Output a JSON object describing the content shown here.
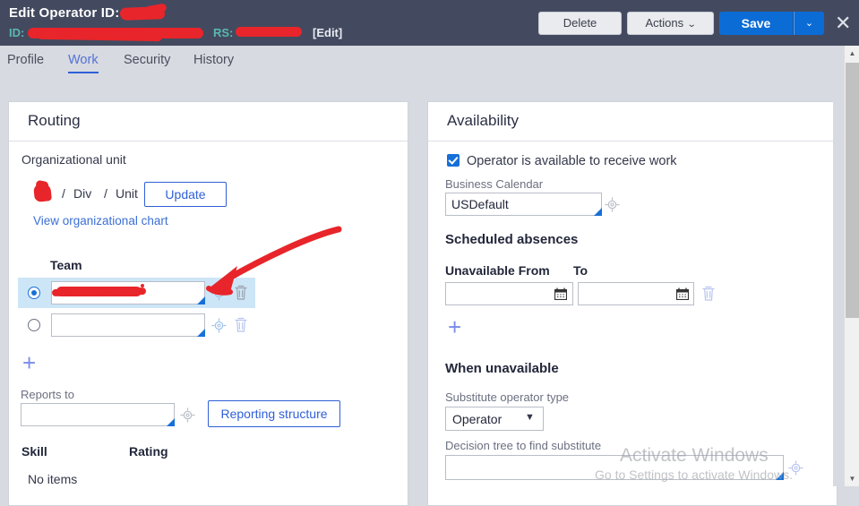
{
  "header": {
    "title": "Edit  Operator ID:",
    "id_label": "ID:",
    "rs_label": "RS:",
    "edit_link": "[Edit]",
    "delete_label": "Delete",
    "actions_label": "Actions",
    "actions_caret": "⌄",
    "save_label": "Save",
    "save_caret": "⌄",
    "close_icon": "✕",
    "bg_color": "#434a60",
    "accent_color": "#0c6cd6",
    "label_color": "#5bb8b0",
    "redaction_color": "#e8252a"
  },
  "tabs": [
    {
      "label": "Profile",
      "active": false
    },
    {
      "label": "Work",
      "active": true
    },
    {
      "label": "Security",
      "active": false
    },
    {
      "label": "History",
      "active": false
    }
  ],
  "routing": {
    "card_title": "Routing",
    "org_unit_label": "Organizational unit",
    "breadcrumb": {
      "sep1": "/",
      "div": "Div",
      "sep2": "/",
      "unit": "Unit"
    },
    "update_button": "Update",
    "org_chart_link": "View organizational chart",
    "team_header": "Team",
    "team_rows": [
      {
        "selected": true,
        "value": "",
        "redacted": true
      },
      {
        "selected": false,
        "value": "",
        "redacted": false
      }
    ],
    "add_team_icon": "+",
    "reports_to_label": "Reports to",
    "reports_to_value": "",
    "reporting_structure_button": "Reporting structure",
    "skill_header": "Skill",
    "rating_header": "Rating",
    "no_items_text": "No items"
  },
  "availability": {
    "card_title": "Availability",
    "available_checkbox_label": "Operator is available to receive work",
    "available_checked": true,
    "business_calendar_label": "Business Calendar",
    "business_calendar_value": "USDefault",
    "scheduled_absences_heading": "Scheduled absences",
    "unavailable_from_header": "Unavailable From",
    "to_header": "To",
    "absence_rows": [
      {
        "from": "",
        "to": ""
      }
    ],
    "add_absence_icon": "+",
    "when_unavailable_heading": "When unavailable",
    "substitute_type_label": "Substitute operator type",
    "substitute_type_value": "Operator",
    "substitute_type_options": [
      "Operator"
    ],
    "decision_tree_label": "Decision tree to find substitute",
    "decision_tree_value": ""
  },
  "watermark": {
    "title": "Activate Windows",
    "subtitle": "Go to Settings to activate Windows."
  },
  "scrollbar": {
    "up_arrow": "▲",
    "down_arrow": "▼"
  }
}
